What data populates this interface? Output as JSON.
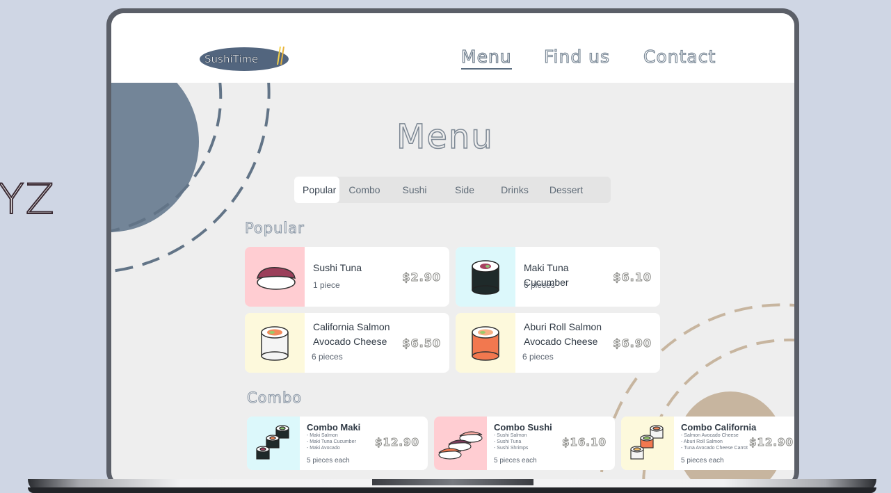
{
  "side_text": "YZ",
  "nav": {
    "logo_text": "SushiTime",
    "links": [
      "Menu",
      "Find us",
      "Contact"
    ]
  },
  "page_title": "Menu",
  "tabs": [
    "Popular",
    "Combo",
    "Sushi",
    "Side",
    "Drinks",
    "Dessert"
  ],
  "sections": {
    "popular_title": "Popular",
    "combo_title": "Combo"
  },
  "popular": [
    {
      "name": "Sushi Tuna",
      "sub": "1 piece",
      "price": "$2.90"
    },
    {
      "name": "Maki Tuna Cucumber",
      "sub": "6 pieces",
      "price": "$6.10"
    },
    {
      "name": "California Salmon Avocado Cheese",
      "sub": "6 pieces",
      "price": "$6.50"
    },
    {
      "name": "Aburi Roll Salmon Avocado Cheese",
      "sub": "6 pieces",
      "price": "$6.90"
    }
  ],
  "combo": [
    {
      "name": "Combo Maki",
      "items": [
        "- Maki Salmon",
        "- Maki Tuna Cucumber",
        "- Maki Avocado"
      ],
      "sub": "5 pieces each",
      "price": "$12.90"
    },
    {
      "name": "Combo Sushi",
      "items": [
        "- Sushi Salmon",
        "- Sushi Tuna",
        "- Sushi Shrimps"
      ],
      "sub": "5 pieces each",
      "price": "$16.10"
    },
    {
      "name": "Combo California",
      "items": [
        "- Salmon Avocado Cheese",
        "- Aburi Roll Salmon",
        "- Tuna Avocado Cheese Carrot"
      ],
      "sub": "5 pieces each",
      "price": "$12.90"
    }
  ],
  "colors": {
    "background": "#cfd6e4",
    "nav_bg": "#ffffff",
    "screen_bg": "#eeeeee",
    "slate_circle": "#738598",
    "tan_circle": "#c7b59f",
    "card_pink": "#ffcdd2",
    "card_cyan": "#dcf8fb",
    "card_cream": "#fdf9dc"
  }
}
